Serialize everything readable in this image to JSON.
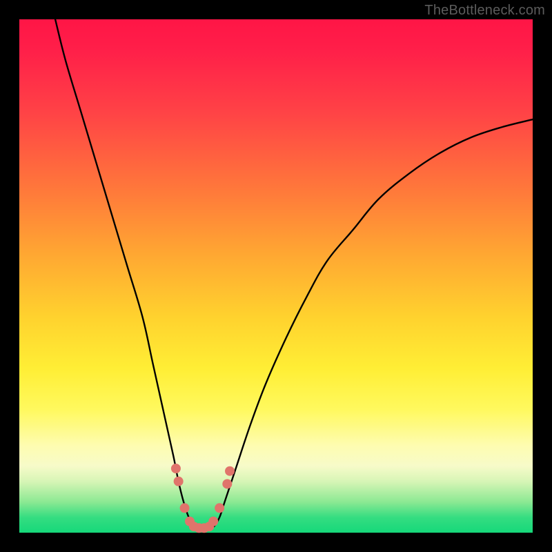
{
  "watermark": "TheBottleneck.com",
  "chart_data": {
    "type": "line",
    "title": "",
    "xlabel": "",
    "ylabel": "",
    "xlim": [
      0,
      100
    ],
    "ylim": [
      0,
      100
    ],
    "series": [
      {
        "name": "bottleneck-curve",
        "x": [
          7,
          9,
          12,
          15,
          18,
          21,
          24,
          26,
          28,
          30,
          31,
          32,
          33,
          34,
          35,
          36,
          37,
          38,
          39,
          40,
          42,
          45,
          48,
          52,
          56,
          60,
          65,
          70,
          76,
          82,
          88,
          94,
          100
        ],
        "y": [
          100,
          92,
          82,
          72,
          62,
          52,
          42,
          33,
          24,
          15,
          10,
          6,
          3,
          1.3,
          0.8,
          0.7,
          0.8,
          1.3,
          3,
          6,
          12,
          21,
          29,
          38,
          46,
          53,
          59,
          65,
          70,
          74,
          77,
          79,
          80.5
        ]
      }
    ],
    "markers": {
      "name": "highlight-dots",
      "color": "#e0746b",
      "points": [
        {
          "x": 30.5,
          "y": 12.5
        },
        {
          "x": 31.0,
          "y": 10.0
        },
        {
          "x": 32.2,
          "y": 4.8
        },
        {
          "x": 33.2,
          "y": 2.2
        },
        {
          "x": 34.0,
          "y": 1.2
        },
        {
          "x": 35.0,
          "y": 0.9
        },
        {
          "x": 36.0,
          "y": 0.9
        },
        {
          "x": 37.0,
          "y": 1.2
        },
        {
          "x": 37.8,
          "y": 2.2
        },
        {
          "x": 39.0,
          "y": 4.8
        },
        {
          "x": 40.5,
          "y": 9.5
        },
        {
          "x": 41.0,
          "y": 12.0
        }
      ]
    },
    "gradient_bands": [
      {
        "label": "red",
        "y": 100
      },
      {
        "label": "orange",
        "y": 55
      },
      {
        "label": "yellow",
        "y": 30
      },
      {
        "label": "pale",
        "y": 14
      },
      {
        "label": "green",
        "y": 3
      }
    ]
  },
  "colors": {
    "curve": "#000000",
    "marker": "#e0746b",
    "frame_bg": "#000000"
  }
}
